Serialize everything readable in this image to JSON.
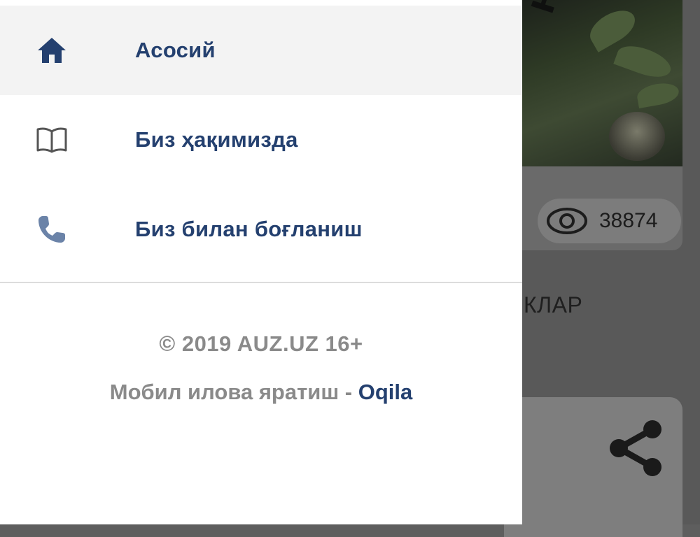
{
  "drawer": {
    "items": [
      {
        "label": "Асосий",
        "icon": "home-icon",
        "active": true
      },
      {
        "label": "Биз ҳақимизда",
        "icon": "book-icon",
        "active": false
      },
      {
        "label": "Биз билан боғланиш",
        "icon": "phone-icon",
        "active": false
      }
    ],
    "footer": {
      "copyright": "© 2019 AUZ.UZ 16+",
      "credit_prefix": "Мобил илова яратиш - ",
      "credit_brand": "Oqila"
    }
  },
  "background": {
    "views_count": "38874",
    "section_title_partial": "КЛАР",
    "poster_text_partial": "НК"
  },
  "colors": {
    "accent": "#24406f",
    "muted_text": "#8a8a8a",
    "active_bg": "#f3f3f3",
    "overlay": "#595959"
  }
}
